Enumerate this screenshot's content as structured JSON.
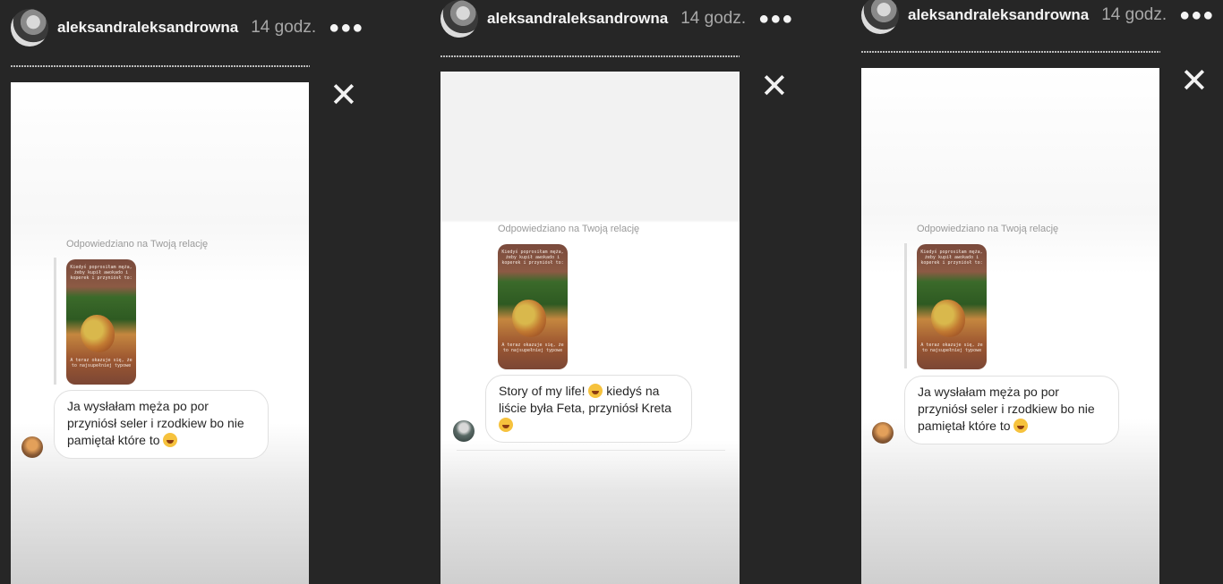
{
  "panels": [
    {
      "username": "aleksandraleksandrowna",
      "time": "14 godz.",
      "replied_label": "Odpowiedziano na Twoją relację",
      "thumb_top_text": "Kiedyś poprosiłam męża, żeby kupił awokado i koperek i przyniósł to:",
      "thumb_bottom_text": "A teraz okazuje się, że to najsupełniej typowe",
      "message_lines": [
        "Ja wysłałam męża po por",
        "przyniósł seler i rzodkiew bo nie",
        "pamiętał które to"
      ]
    },
    {
      "username": "aleksandraleksandrowna",
      "time": "14 godz.",
      "replied_label": "Odpowiedziano na Twoją relację",
      "thumb_top_text": "Kiedyś poprosiłam męża, żeby kupił awokado i koperek i przyniósł to:",
      "thumb_bottom_text": "A teraz okazuje się, że to najsupełniej typowe",
      "message_lines": [
        "Story of my life!",
        "kiedyś na",
        "liście była Feta, przyniósł Kreta"
      ]
    },
    {
      "username": "aleksandraleksandrowna",
      "time": "14 godz.",
      "replied_label": "Odpowiedziano na Twoją relację",
      "thumb_top_text": "Kiedyś poprosiłam męża, żeby kupił awokado i koperek i przyniósł to:",
      "thumb_bottom_text": "A teraz okazuje się, że to najsupełniej typowe",
      "message_lines": [
        "Ja wysłałam męża po por",
        "przyniósł seler i rzodkiew bo nie",
        "pamiętał które to"
      ]
    }
  ],
  "icons": {
    "more": "more-dots-icon",
    "close": "close-icon",
    "emoji": "laughing-emoji-icon"
  },
  "colors": {
    "background": "#262626",
    "card": "#ffffff",
    "text": "#262626",
    "muted": "#9a9a9a"
  }
}
